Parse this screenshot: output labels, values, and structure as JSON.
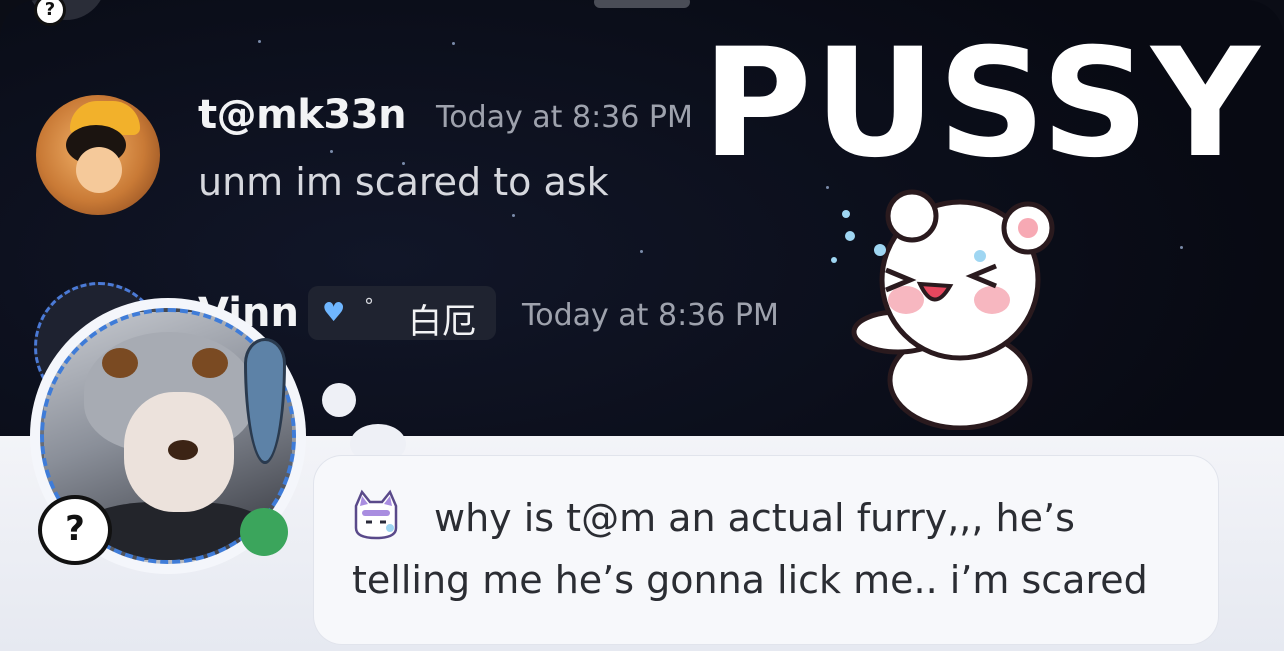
{
  "messages": [
    {
      "username": "t@mk33n",
      "timestamp": "Today at 8:36 PM",
      "text": "unm im scared to ask"
    },
    {
      "username": "Vinn",
      "tag": {
        "icon": "blue-heart-icon",
        "symbol": "°",
        "text": "白厄"
      },
      "timestamp": "Today at 8:36 PM"
    }
  ],
  "sticker": {
    "text": "PUSSY",
    "image": "crying-bear-sticker"
  },
  "profile_status": {
    "emoji": "cat-emoji",
    "text_line1": "why is t@m an actual furry,,, he’s",
    "text_line2": "telling me he’s gonna lick me.. i’m scared",
    "online_status": "online",
    "badge": "question-mark-icon"
  },
  "colors": {
    "online": "#3ba55c",
    "accent": "#3f7cd8"
  }
}
